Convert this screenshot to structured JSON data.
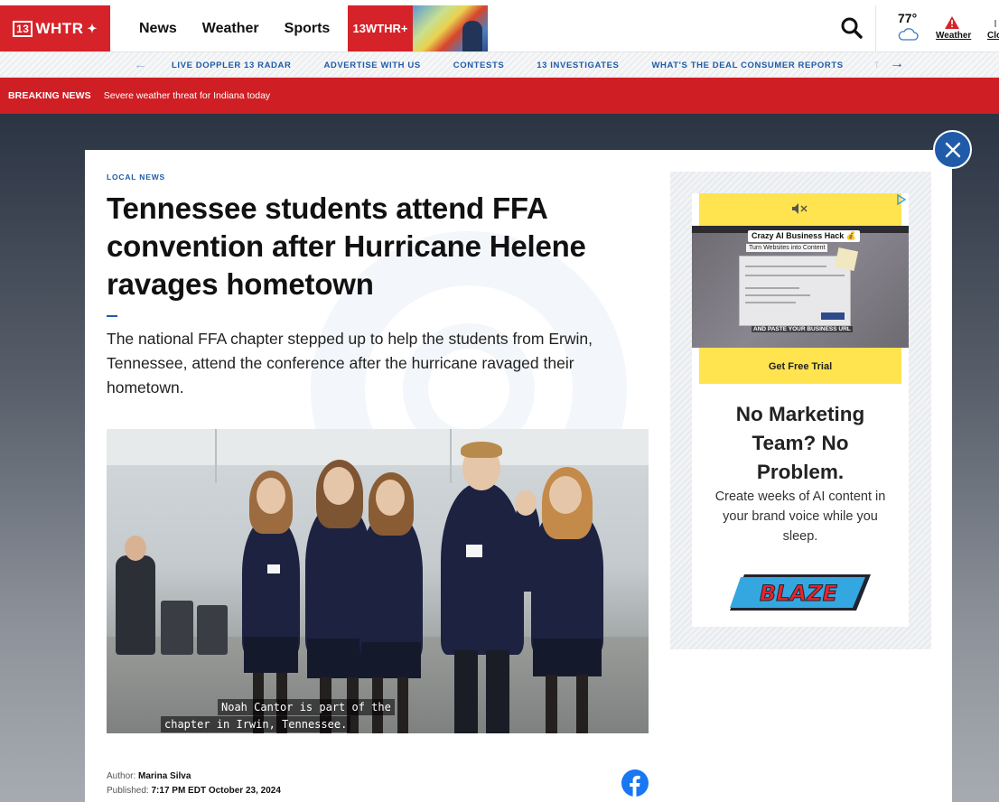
{
  "header": {
    "logo_text": "WHTR",
    "logo_number": "13",
    "nav": [
      "News",
      "Weather",
      "Sports"
    ],
    "plus_label": "13WTHR+",
    "temperature": "77°",
    "weather_label": "Weather",
    "clo_label": "Clo"
  },
  "subnav": {
    "links": [
      "LIVE DOPPLER 13 RADAR",
      "ADVERTISE WITH US",
      "CONTESTS",
      "13 INVESTIGATES",
      "WHAT'S THE DEAL CONSUMER REPORTS"
    ]
  },
  "breaking": {
    "label": "BREAKING NEWS",
    "text": "Severe weather threat for Indiana today"
  },
  "article": {
    "section": "LOCAL NEWS",
    "headline": "Tennessee students attend FFA convention after Hurricane Helene ravages hometown",
    "dek": "The national FFA chapter stepped up to help the students from Erwin, Tennessee, attend the conference after the hurricane ravaged their hometown.",
    "caption_line1": "Noah Cantor is part of the",
    "caption_line2": "chapter in Irwin, Tennessee.",
    "author_label": "Author:",
    "author": "Marina Silva",
    "published_label": "Published:",
    "published": "7:17 PM EDT October 23, 2024"
  },
  "ad": {
    "video_title": "Crazy AI Business Hack 💰",
    "video_subtitle_bar": "Turn Websites into Content",
    "video_caption": "AND PASTE YOUR BUSINESS URL",
    "cta": "Get Free Trial",
    "headline": "No Marketing Team? No Problem.",
    "subtext": "Create weeks of AI content in your brand voice while you sleep.",
    "brand": "BLAZE"
  },
  "colors": {
    "brand_red": "#d6232a",
    "breaking_red": "#cf1f25",
    "link_blue": "#1f5ba8",
    "ad_yellow": "#ffe44f"
  }
}
